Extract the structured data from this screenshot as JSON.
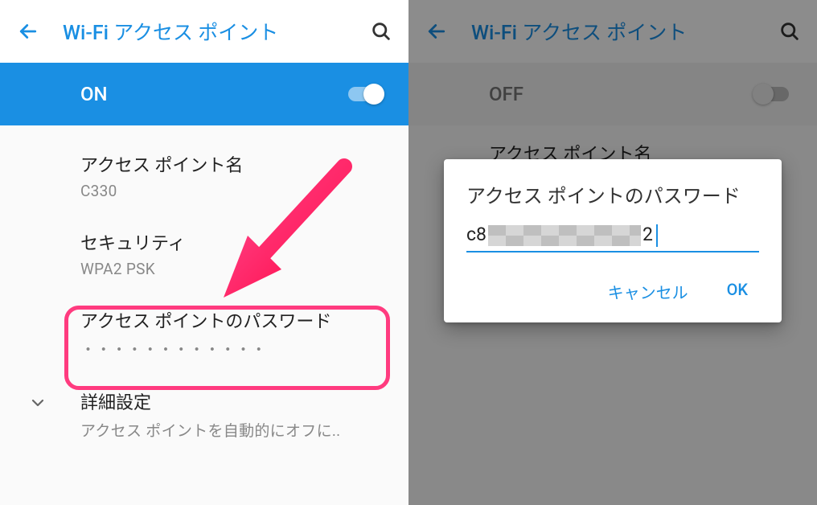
{
  "left": {
    "header": {
      "title": "Wi-Fi アクセス ポイント"
    },
    "toggle": {
      "state": "ON"
    },
    "items": {
      "ap_name": {
        "label": "アクセス ポイント名",
        "value": "C330"
      },
      "security": {
        "label": "セキュリティ",
        "value": "WPA2 PSK"
      },
      "password": {
        "label": "アクセス ポイントのパスワード",
        "value": "・・・・・・・・・・・・"
      },
      "advanced": {
        "label": "詳細設定",
        "value": "アクセス ポイントを自動的にオフに.."
      }
    }
  },
  "right": {
    "header": {
      "title": "Wi-Fi アクセス ポイント"
    },
    "toggle": {
      "state": "OFF"
    },
    "items": {
      "ap_name": {
        "label": "アクセス ポイント名"
      }
    },
    "dialog": {
      "title": "アクセス ポイントのパスワード",
      "value_prefix": "c8",
      "value_suffix": "2",
      "cancel": "キャンセル",
      "ok": "OK"
    }
  }
}
